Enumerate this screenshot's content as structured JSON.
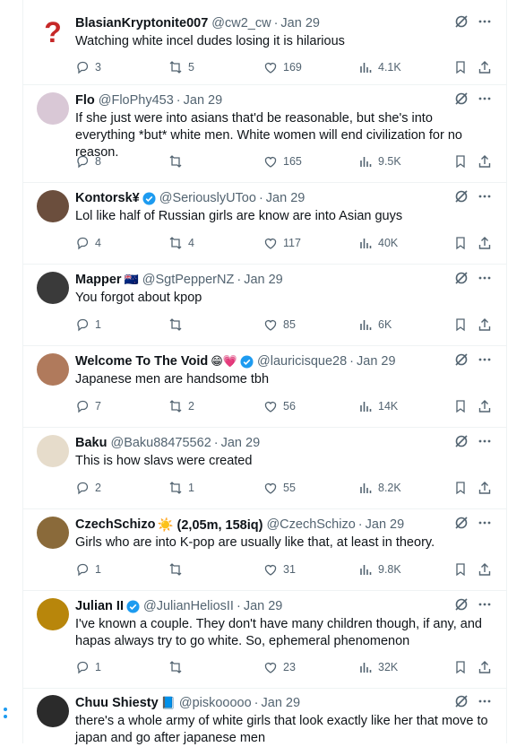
{
  "tweets": [
    {
      "name": "BlasianKryptonite007",
      "name_suffix": "",
      "verified": false,
      "handle": "@cw2_cw",
      "date": "Jan 29",
      "text": "Watching white incel dudes losing it is hilarious",
      "replies": "3",
      "reposts": "5",
      "likes": "169",
      "views": "4.1K",
      "avatar_color": "#c62828"
    },
    {
      "name": "Flo",
      "name_suffix": "",
      "verified": false,
      "handle": "@FloPhy453",
      "date": "Jan 29",
      "text": "If she just were into asians that'd be reasonable, but she's into everything *but* white men. White women will end civilization for no reason.",
      "replies": "8",
      "reposts": "",
      "likes": "165",
      "views": "9.5K",
      "avatar_color": "#d9c8d6"
    },
    {
      "name": "Kontorsk¥",
      "name_suffix": "",
      "verified": true,
      "handle": "@SeriouslyUToo",
      "date": "Jan 29",
      "text": "Lol like half of Russian girls are know are into Asian guys",
      "replies": "4",
      "reposts": "4",
      "likes": "117",
      "views": "40K",
      "avatar_color": "#6b4e3d"
    },
    {
      "name": "Mapper",
      "name_suffix": "🇳🇿",
      "verified": false,
      "handle": "@SgtPepperNZ",
      "date": "Jan 29",
      "text": "You forgot about kpop",
      "replies": "1",
      "reposts": "",
      "likes": "85",
      "views": "6K",
      "avatar_color": "#3a3a3a"
    },
    {
      "name": "Welcome To The Void",
      "name_suffix": "😁💗",
      "verified": true,
      "handle": "@lauricisque28",
      "date": "Jan 29",
      "text": "Japanese men are handsome tbh",
      "replies": "7",
      "reposts": "2",
      "likes": "56",
      "views": "14K",
      "avatar_color": "#b07a5c"
    },
    {
      "name": "Baku",
      "name_suffix": "",
      "verified": false,
      "handle": "@Baku88475562",
      "date": "Jan 29",
      "text": "This is how slavs were created",
      "replies": "2",
      "reposts": "1",
      "likes": "55",
      "views": "8.2K",
      "avatar_color": "#e6dccb"
    },
    {
      "name": "CzechSchizo",
      "name_suffix": "☀️ (2,05m, 158iq)",
      "verified": false,
      "handle": "@CzechSchizo",
      "date": "Jan 29",
      "text": "Girls who are into K-pop are usually like that, at least in theory.",
      "replies": "1",
      "reposts": "",
      "likes": "31",
      "views": "9.8K",
      "avatar_color": "#8a6a3a"
    },
    {
      "name": "Julian II",
      "name_suffix": "",
      "verified": true,
      "handle": "@JulianHeliosII",
      "date": "Jan 29",
      "text": "I've known a couple. They don't have many children though, if any, and hapas always try to go white. So, ephemeral phenomenon",
      "replies": "1",
      "reposts": "",
      "likes": "23",
      "views": "32K",
      "avatar_color": "#b8860b"
    },
    {
      "name": "Chuu Shiesty",
      "name_suffix": "📘",
      "verified": false,
      "handle": "@piskooooo",
      "date": "Jan 29",
      "text": "there's a whole army of white girls that look exactly like her that move to japan and go after japanese men",
      "replies": "",
      "reposts": "",
      "likes": "",
      "views": "",
      "avatar_color": "#2b2b2b"
    }
  ]
}
